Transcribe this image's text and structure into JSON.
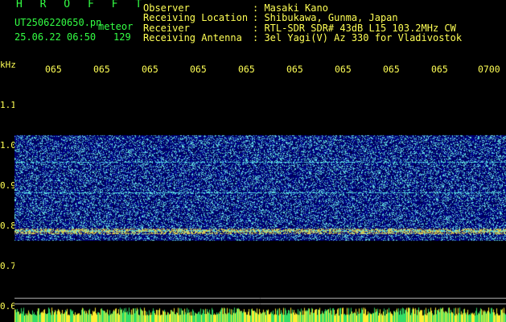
{
  "station": {
    "title": "H R O F F T",
    "filename": "UT2506220650.pn",
    "sublabel": "meteor",
    "datetime": "25.06.22 06:50",
    "count": "129"
  },
  "info": {
    "rows": [
      {
        "label": "Observer",
        "value": ": Masaki Kano"
      },
      {
        "label": "Receiving Location",
        "value": ": Shibukawa, Gunma, Japan"
      },
      {
        "label": "Receiver",
        "value": ": RTL-SDR SDR# 43dB L15 103.2MHz CW"
      },
      {
        "label": "Receiving Antenna",
        "value": ": 3el Yagi(V) Az 330 for Vladivostok"
      }
    ]
  },
  "axis": {
    "unit": "kHz",
    "y_ticks": [
      "1.1",
      "1.0",
      "0.9",
      "0.8",
      "0.7",
      "0.6"
    ],
    "x_ticks": [
      "065",
      "065",
      "065",
      "065",
      "065",
      "065",
      "065",
      "065",
      "065",
      "0700"
    ]
  },
  "colors": {
    "text_yellow": "#ffff55",
    "text_green": "#33ff44",
    "background": "#000000",
    "noise_blue": "#1a3cff",
    "signal_cyan": "#66ffee"
  }
}
